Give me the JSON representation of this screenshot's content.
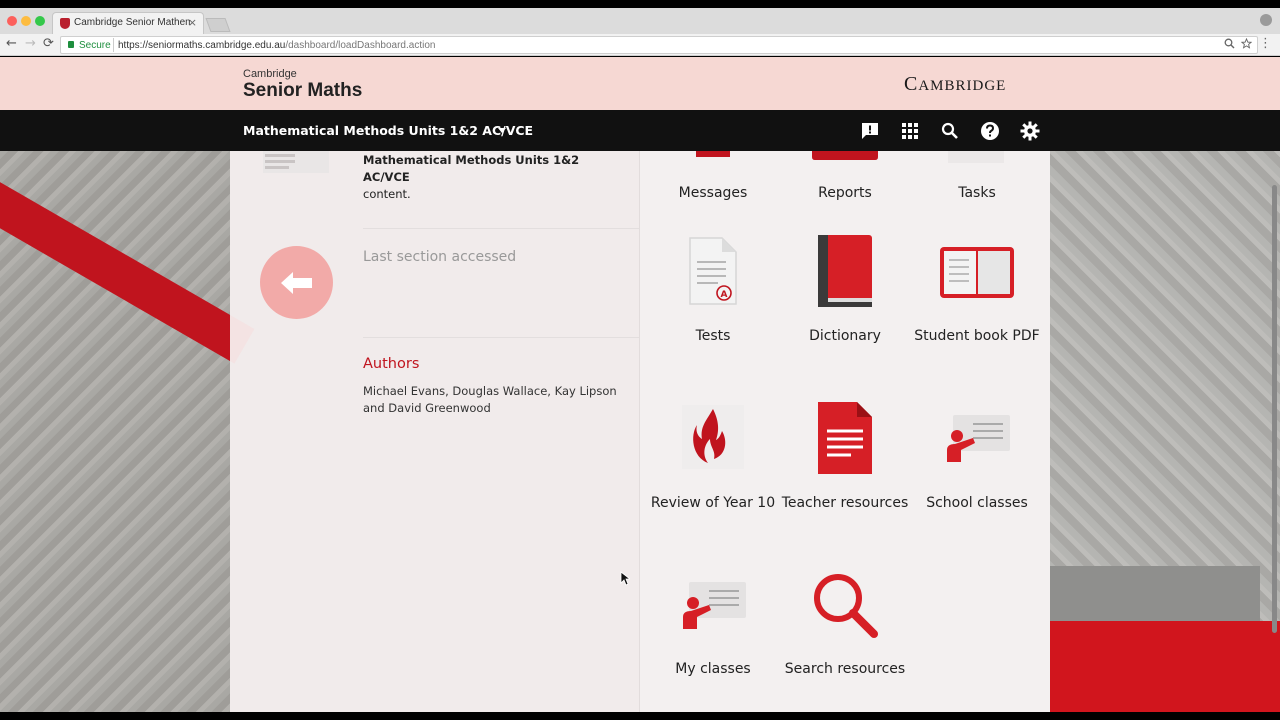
{
  "browser": {
    "tab_title": "Cambridge Senior Mathematic",
    "tab_close": "×",
    "secure_label": "Secure",
    "url_host": "https://seniormaths.cambridge.edu.au",
    "url_path": "/dashboard/loadDashboard.action",
    "nav": {
      "back": "←",
      "forward": "→",
      "reload": "⟳"
    },
    "icons": [
      "back-icon",
      "forward-icon",
      "reload-icon",
      "lock-icon",
      "zoom-icon",
      "star-icon",
      "menu-icon"
    ]
  },
  "header": {
    "brand_small": "Cambridge",
    "brand_big": "Senior Maths",
    "publisher_first": "C",
    "publisher_rest": "AMBRIDGE"
  },
  "navbar": {
    "course_title": "Mathematical Methods Units 1&2 AC/VCE",
    "icons": [
      "feedback-icon",
      "apps-grid-icon",
      "search-icon",
      "help-icon",
      "settings-icon"
    ]
  },
  "left_panel": {
    "course_bold": "Mathematical Methods Units 1&2 AC/VCE",
    "course_suffix": "content.",
    "last_section": "Last section accessed",
    "authors_heading": "Authors",
    "authors": "Michael Evans, Douglas Wallace, Kay Lipson and David Greenwood"
  },
  "tiles": [
    {
      "label": "Messages",
      "icon": "messages-icon"
    },
    {
      "label": "Reports",
      "icon": "reports-icon"
    },
    {
      "label": "Tasks",
      "icon": "tasks-icon"
    },
    {
      "label": "Tests",
      "icon": "test-document-icon"
    },
    {
      "label": "Dictionary",
      "icon": "dictionary-book-icon"
    },
    {
      "label": "Student book PDF",
      "icon": "open-book-icon"
    },
    {
      "label": "Review of Year 10",
      "icon": "flame-icon"
    },
    {
      "label": "Teacher resources",
      "icon": "document-icon"
    },
    {
      "label": "School classes",
      "icon": "presenter-board-icon"
    },
    {
      "label": "My classes",
      "icon": "presenter-board-icon"
    },
    {
      "label": "Search resources",
      "icon": "magnifier-icon"
    }
  ],
  "colors": {
    "accent": "#c0141e",
    "header_bg": "#f6d8d3",
    "navbar_bg": "#111111"
  }
}
